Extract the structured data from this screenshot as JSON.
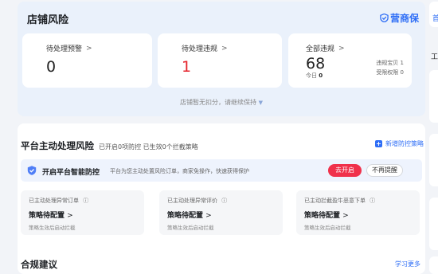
{
  "top_card": {
    "title": "店铺风险",
    "brand": "营商保",
    "brand_color": "#2d6df6",
    "stats": [
      {
        "label": "待处理预警",
        "value": "0"
      },
      {
        "label": "待处理违规",
        "value": "1"
      },
      {
        "label": "全部违规",
        "value": "68",
        "today_label": "今日",
        "today_value": "0",
        "side": [
          "违规宝贝 1",
          "受限权限 0"
        ]
      }
    ],
    "footnote": "店铺暂无扣分，请继续保持"
  },
  "right_col": {
    "text_1": "首",
    "text_2": "工"
  },
  "platform": {
    "title": "平台主动处理风险",
    "subtitle": "已开启0项防控 已生效0个拦截策略",
    "add_label": "新增防控策略",
    "banner": {
      "title": "开启平台智能防控",
      "desc": "平台为您主动处置风险订单，商家免操作，快速获得保护",
      "open_label": "去开启",
      "noremind_label": "不再提醒",
      "accent": "#f0314b"
    },
    "cards": [
      {
        "title": "已主动处理异常订单",
        "main": "策略待配置",
        "foot": "策略生效后启动拦截"
      },
      {
        "title": "已主动处理异常评价",
        "main": "策略待配置",
        "foot": "策略生效后启动拦截"
      },
      {
        "title": "已主动拦截盈牛恶意下单",
        "main": "策略待配置",
        "foot": "策略生效后启动拦截"
      }
    ]
  },
  "compliance": {
    "title": "合规建议",
    "learn_more": "学习更多"
  }
}
